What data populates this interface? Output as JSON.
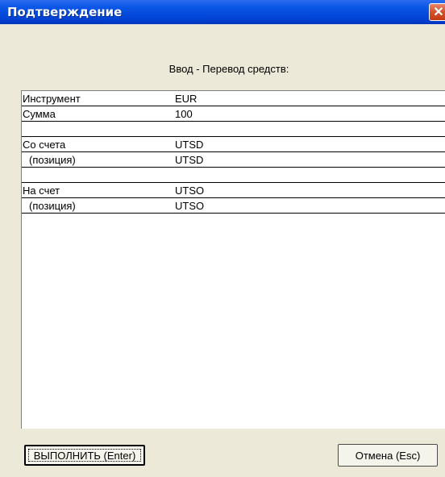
{
  "window": {
    "title": "Подтверждение",
    "close_symbol": "✕"
  },
  "form": {
    "subtitle": "Ввод - Перевод средств:",
    "rows": [
      {
        "label": "Инструмент",
        "value": "EUR"
      },
      {
        "label": "Сумма",
        "value": "100"
      },
      {
        "label": "",
        "value": ""
      },
      {
        "label": "Со счета",
        "value": "UTSD"
      },
      {
        "label": "(позиция)",
        "value": "UTSD"
      },
      {
        "label": "",
        "value": ""
      },
      {
        "label": "На счет",
        "value": "UTSO"
      },
      {
        "label": "(позиция)",
        "value": "UTSO"
      }
    ]
  },
  "buttons": {
    "ok_label": "ВЫПОЛНИТЬ (Enter)",
    "cancel_label": "Отмена (Esc)"
  }
}
